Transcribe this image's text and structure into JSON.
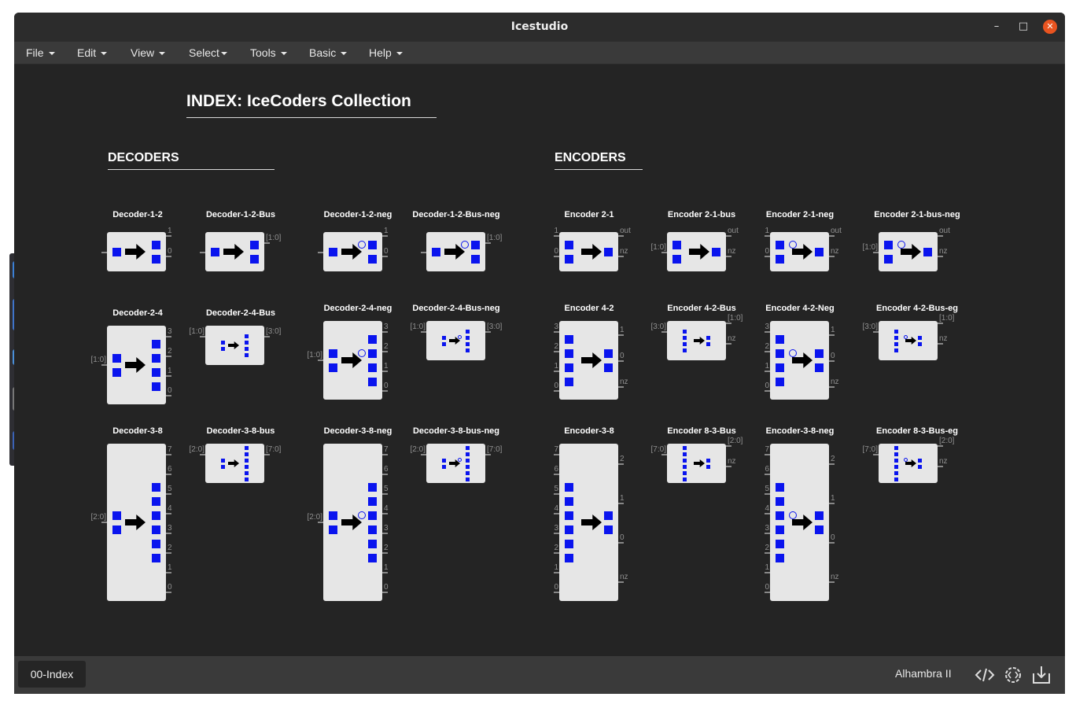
{
  "window": {
    "title": "Icestudio"
  },
  "menu": [
    {
      "label": "File"
    },
    {
      "label": "Edit"
    },
    {
      "label": "View"
    },
    {
      "label": "Select"
    },
    {
      "label": "Tools"
    },
    {
      "label": "Basic"
    },
    {
      "label": "Help"
    }
  ],
  "index_title": "INDEX: IceCoders Collection",
  "sections": {
    "decoders": "DECODERS",
    "encoders": "ENCODERS"
  },
  "statusbar": {
    "tab": "00-Index",
    "board": "Alhambra II"
  },
  "colors": {
    "accent_blue": "#0a14ee",
    "block_bg": "#e6e6e6",
    "canvas_bg": "#242424",
    "close_button": "#e95420"
  },
  "blocks": [
    {
      "name": "Decoder-1-2",
      "kind": "dec",
      "outs": 2,
      "neg": false,
      "inputs": [
        ""
      ],
      "outputs": [
        "1",
        "0"
      ]
    },
    {
      "name": "Decoder-1-2-Bus",
      "kind": "dec",
      "outs": 2,
      "neg": false,
      "inputs": [
        ""
      ],
      "outputs": [
        "[1:0]"
      ]
    },
    {
      "name": "Decoder-1-2-neg",
      "kind": "dec",
      "outs": 2,
      "neg": true,
      "inputs": [
        ""
      ],
      "outputs": [
        "1",
        "0"
      ]
    },
    {
      "name": "Decoder-1-2-Bus-neg",
      "kind": "dec",
      "outs": 2,
      "neg": true,
      "inputs": [
        ""
      ],
      "outputs": [
        "[1:0]"
      ]
    },
    {
      "name": "Encoder 2-1",
      "kind": "enc",
      "ins": 2,
      "neg": false,
      "inputs": [
        "1",
        "0"
      ],
      "outputs": [
        "out",
        "nz"
      ]
    },
    {
      "name": "Encoder 2-1-bus",
      "kind": "enc",
      "ins": 2,
      "neg": false,
      "inputs": [
        "[1:0]"
      ],
      "outputs": [
        "out",
        "nz"
      ]
    },
    {
      "name": "Encoder 2-1-neg",
      "kind": "enc",
      "ins": 2,
      "neg": true,
      "inputs": [
        "1",
        "0"
      ],
      "outputs": [
        "out",
        "nz"
      ]
    },
    {
      "name": "Encoder 2-1-bus-neg",
      "kind": "enc",
      "ins": 2,
      "neg": true,
      "inputs": [
        "[1:0]"
      ],
      "outputs": [
        "out",
        "nz"
      ]
    },
    {
      "name": "Decoder-2-4",
      "kind": "dec",
      "outs": 4,
      "neg": false,
      "inputs": [
        "[1:0]"
      ],
      "outputs": [
        "3",
        "2",
        "1",
        "0"
      ]
    },
    {
      "name": "Decoder-2-4-Bus",
      "kind": "dec",
      "outs": 4,
      "neg": false,
      "inputs": [
        "[1:0]"
      ],
      "outputs": [
        "[3:0]"
      ]
    },
    {
      "name": "Decoder-2-4-neg",
      "kind": "dec",
      "outs": 4,
      "neg": true,
      "inputs": [
        "[1:0]"
      ],
      "outputs": [
        "3",
        "2",
        "1",
        "0"
      ]
    },
    {
      "name": "Decoder-2-4-Bus-neg",
      "kind": "dec",
      "outs": 4,
      "neg": true,
      "inputs": [
        "[1:0]"
      ],
      "outputs": [
        "[3:0]"
      ]
    },
    {
      "name": "Encoder 4-2",
      "kind": "enc",
      "ins": 4,
      "neg": false,
      "inputs": [
        "3",
        "2",
        "1",
        "0"
      ],
      "outputs": [
        "1",
        "0",
        "nz"
      ]
    },
    {
      "name": "Encoder 4-2-Bus",
      "kind": "enc",
      "ins": 4,
      "neg": false,
      "inputs": [
        "[3:0]"
      ],
      "outputs": [
        "[1:0]",
        "nz"
      ]
    },
    {
      "name": "Encoder 4-2-Neg",
      "kind": "enc",
      "ins": 4,
      "neg": true,
      "inputs": [
        "3",
        "2",
        "1",
        "0"
      ],
      "outputs": [
        "1",
        "0",
        "nz"
      ]
    },
    {
      "name": "Encoder 4-2-Bus-eg",
      "kind": "enc",
      "ins": 4,
      "neg": true,
      "inputs": [
        "[3:0]"
      ],
      "outputs": [
        "[1:0]",
        "nz"
      ]
    },
    {
      "name": "Decoder-3-8",
      "kind": "dec",
      "outs": 8,
      "neg": false,
      "inputs": [
        "[2:0]"
      ],
      "outputs": [
        "7",
        "6",
        "5",
        "4",
        "3",
        "2",
        "1",
        "0"
      ]
    },
    {
      "name": "Decoder-3-8-bus",
      "kind": "dec",
      "outs": 8,
      "neg": false,
      "inputs": [
        "[2:0]"
      ],
      "outputs": [
        "[7:0]"
      ]
    },
    {
      "name": "Decoder-3-8-neg",
      "kind": "dec",
      "outs": 8,
      "neg": true,
      "inputs": [
        "[2:0]"
      ],
      "outputs": [
        "7",
        "6",
        "5",
        "4",
        "3",
        "2",
        "1",
        "0"
      ]
    },
    {
      "name": "Decoder-3-8-bus-neg",
      "kind": "dec",
      "outs": 8,
      "neg": true,
      "inputs": [
        "[2:0]"
      ],
      "outputs": [
        "[7:0]"
      ]
    },
    {
      "name": "Encoder-3-8",
      "kind": "enc",
      "ins": 8,
      "neg": false,
      "inputs": [
        "7",
        "6",
        "5",
        "4",
        "3",
        "2",
        "1",
        "0"
      ],
      "outputs": [
        "2",
        "1",
        "0",
        "nz"
      ]
    },
    {
      "name": "Encoder 8-3-Bus",
      "kind": "enc",
      "ins": 8,
      "neg": false,
      "inputs": [
        "[7:0]"
      ],
      "outputs": [
        "[2:0]",
        "nz"
      ]
    },
    {
      "name": "Encoder-3-8-neg",
      "kind": "enc",
      "ins": 8,
      "neg": true,
      "inputs": [
        "7",
        "6",
        "5",
        "4",
        "3",
        "2",
        "1",
        "0"
      ],
      "outputs": [
        "2",
        "1",
        "0",
        "nz"
      ]
    },
    {
      "name": "Encoder 8-3-Bus-eg",
      "kind": "enc",
      "ins": 8,
      "neg": true,
      "inputs": [
        "[7:0]"
      ],
      "outputs": [
        "[2:0]",
        "nz"
      ]
    }
  ]
}
